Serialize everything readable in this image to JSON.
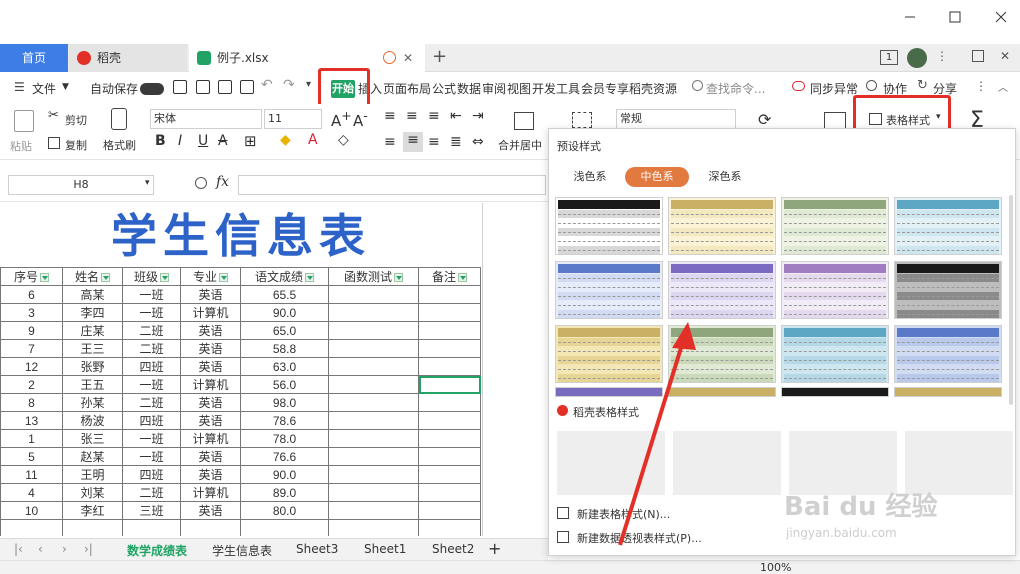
{
  "window": {
    "tabs": [
      {
        "label": "首页"
      },
      {
        "label": "稻壳"
      },
      {
        "label": "例子.xlsx"
      }
    ],
    "page_indicator": "1"
  },
  "menu": {
    "file": "文件",
    "autosave": "自动保存",
    "items": [
      "开始",
      "插入",
      "页面布局",
      "公式",
      "数据",
      "审阅",
      "视图",
      "开发工具",
      "会员专享",
      "稻壳资源"
    ],
    "search_placeholder": "查找命令...",
    "sync": "同步异常",
    "collab": "协作",
    "share": "分享"
  },
  "ribbon": {
    "paste": "粘贴",
    "cut": "剪切",
    "copy": "复制",
    "format_painter": "格式刷",
    "font_name": "宋体",
    "font_size": "11",
    "merge": "合并居中",
    "number_format": "常规",
    "table_style": "表格样式"
  },
  "formula_bar": {
    "cell_ref": "H8",
    "fx": "fx"
  },
  "sheet": {
    "title": "学生信息表",
    "headers": [
      "序号",
      "姓名",
      "班级",
      "专业",
      "语文成绩",
      "函数测试",
      "备注"
    ],
    "rows": [
      [
        "6",
        "高某",
        "一班",
        "英语",
        "65.5"
      ],
      [
        "3",
        "李四",
        "一班",
        "计算机",
        "90.0"
      ],
      [
        "9",
        "庄某",
        "二班",
        "英语",
        "65.0"
      ],
      [
        "7",
        "王三",
        "二班",
        "英语",
        "58.8"
      ],
      [
        "12",
        "张野",
        "四班",
        "英语",
        "63.0"
      ],
      [
        "2",
        "王五",
        "一班",
        "计算机",
        "56.0"
      ],
      [
        "8",
        "孙某",
        "二班",
        "英语",
        "98.0"
      ],
      [
        "13",
        "杨波",
        "四班",
        "英语",
        "78.6"
      ],
      [
        "1",
        "张三",
        "一班",
        "计算机",
        "78.0"
      ],
      [
        "5",
        "赵某",
        "一班",
        "英语",
        "76.6"
      ],
      [
        "11",
        "王明",
        "四班",
        "英语",
        "90.0"
      ],
      [
        "4",
        "刘某",
        "二班",
        "计算机",
        "89.0"
      ],
      [
        "10",
        "李红",
        "三班",
        "英语",
        "80.0"
      ]
    ],
    "selected_cell": "H8"
  },
  "sheet_tabs": {
    "tabs": [
      "数学成绩表",
      "学生信息表",
      "Sheet3",
      "Sheet1",
      "Sheet2"
    ],
    "active": "数学成绩表",
    "zoom": "100%"
  },
  "style_panel": {
    "title": "预设样式",
    "segments": [
      "浅色系",
      "中色系",
      "深色系"
    ],
    "active_segment": "中色系",
    "daoke_title": "稻壳表格样式",
    "new_table_style": "新建表格样式(N)...",
    "new_pivot_style": "新建数据透视表样式(P)..."
  },
  "watermark": {
    "text": "Bai du 经验",
    "sub": "jingyan.baidu.com"
  },
  "colors": {
    "accent_blue": "#3d7de6",
    "accent_green": "#21a366",
    "orange_segment": "#e2793e",
    "annotation_red": "#e23028"
  }
}
